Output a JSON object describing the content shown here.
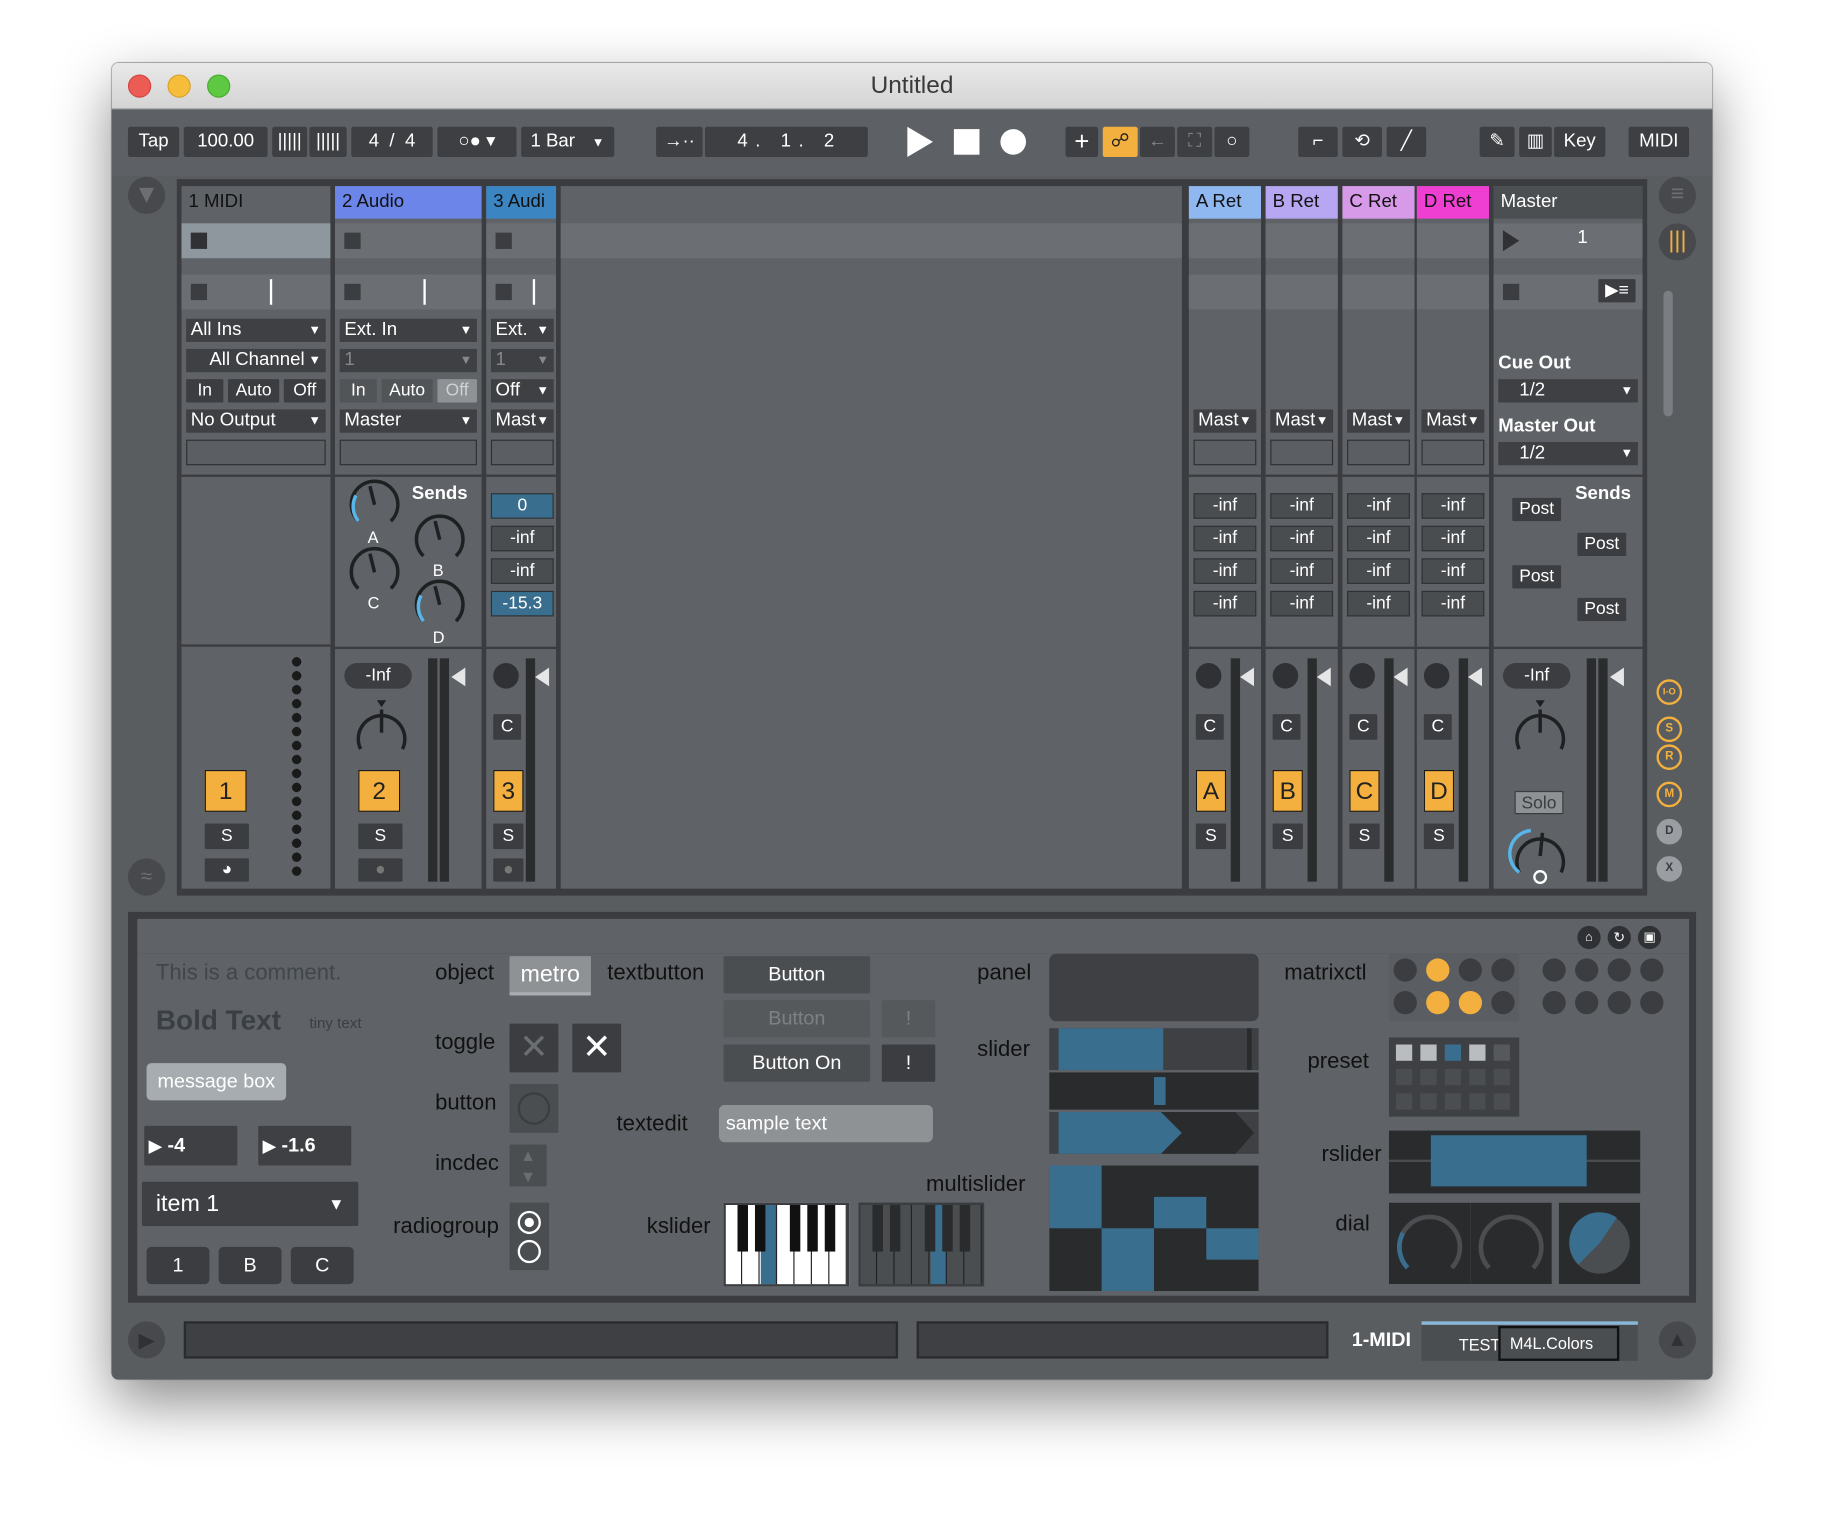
{
  "window": {
    "title": "Untitled"
  },
  "transport": {
    "tap": "Tap",
    "tempo": "100.00",
    "sig_num": "4",
    "sig_slash": "/",
    "sig_den": "4",
    "quant": "1 Bar",
    "pos1": "4",
    "pos2": "1",
    "pos3": "2",
    "key": "Key",
    "midi": "MIDI"
  },
  "tracks": [
    {
      "name": "1 MIDI",
      "color": "#8a9196",
      "input": "All Ins",
      "channel": "All Channel",
      "monitor": [
        "In",
        "Auto",
        "Off"
      ],
      "output": "No Output",
      "number": "1",
      "solo": "S"
    },
    {
      "name": "2 Audio",
      "color": "#6b86e8",
      "input": "Ext. In",
      "channel": "1",
      "monitor": [
        "In",
        "Auto",
        "Off"
      ],
      "output": "Master",
      "number": "2",
      "solo": "S",
      "volume": "-Inf"
    },
    {
      "name": "3 Audi",
      "color": "#3b85c2",
      "input": "Ext.",
      "channel": "1",
      "monitor_off": "Off",
      "output": "Mast",
      "number": "3",
      "solo": "S",
      "xfade": "C"
    }
  ],
  "sends_title": "Sends",
  "knob_labels": [
    "A",
    "B",
    "C",
    "D"
  ],
  "track3_sends": [
    "0",
    "-inf",
    "-inf",
    "-15.3"
  ],
  "returns": [
    {
      "name": "A Ret",
      "color": "#8fb7f0",
      "output": "Mast",
      "sends": [
        "-inf",
        "-inf",
        "-inf",
        "-inf"
      ],
      "xfade": "C",
      "letter": "A",
      "solo": "S"
    },
    {
      "name": "B Ret",
      "color": "#b7a6f2",
      "output": "Mast",
      "sends": [
        "-inf",
        "-inf",
        "-inf",
        "-inf"
      ],
      "xfade": "C",
      "letter": "B",
      "solo": "S"
    },
    {
      "name": "C Ret",
      "color": "#d69ae8",
      "output": "Mast",
      "sends": [
        "-inf",
        "-inf",
        "-inf",
        "-inf"
      ],
      "xfade": "C",
      "letter": "C",
      "solo": "S"
    },
    {
      "name": "D Ret",
      "color": "#ee3fd2",
      "output": "Mast",
      "sends": [
        "-inf",
        "-inf",
        "-inf",
        "-inf"
      ],
      "xfade": "C",
      "letter": "D",
      "solo": "S"
    }
  ],
  "master": {
    "name": "Master",
    "scene": "1",
    "cue_out_label": "Cue Out",
    "cue_out": "1/2",
    "master_out_label": "Master Out",
    "master_out": "1/2",
    "sends_title": "Sends",
    "post": [
      "Post",
      "Post",
      "Post",
      "Post"
    ],
    "volume": "-Inf",
    "solo": "Solo"
  },
  "side_buttons": [
    "I-O",
    "S",
    "R",
    "M",
    "D",
    "X"
  ],
  "device": {
    "comment": "This is a comment.",
    "bold_text": "Bold Text",
    "tiny_text": "tiny text",
    "message": "message box",
    "number1": "-4",
    "number2": "-1.6",
    "menu": "item 1",
    "tabs": [
      "1",
      "B",
      "C"
    ],
    "object_label": "object",
    "object_name": "metro",
    "textbutton_label": "textbutton",
    "button1": "Button",
    "button2": "Button",
    "button2_aux": "!",
    "button_on": "Button On",
    "button_on_aux": "!",
    "toggle_label": "toggle",
    "button_label": "button",
    "incdec_label": "incdec",
    "radiogroup_label": "radiogroup",
    "textedit_label": "textedit",
    "textedit_value": "sample text",
    "kslider_label": "kslider",
    "panel_label": "panel",
    "slider_label": "slider",
    "multislider_label": "multislider",
    "matrixctl_label": "matrixctl",
    "preset_label": "preset",
    "rslider_label": "rslider",
    "dial_label": "dial"
  },
  "status": {
    "track": "1-MIDI",
    "device1": "TEST",
    "device2": "M4L.Colors"
  }
}
